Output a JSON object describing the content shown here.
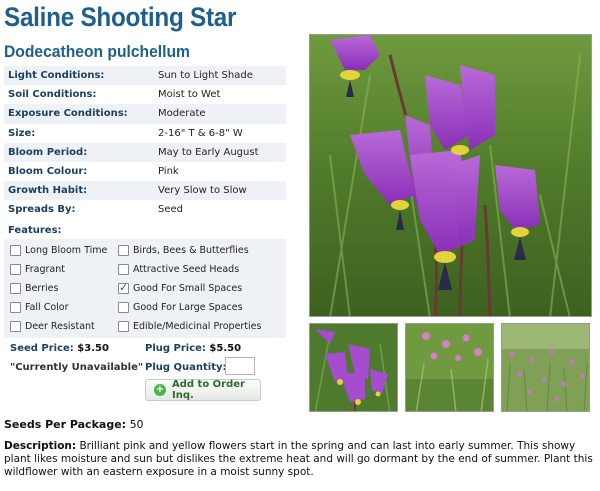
{
  "plant": {
    "common_name": "Saline Shooting Star",
    "latin_name": "Dodecatheon pulchellum"
  },
  "attributes": [
    {
      "label": "Light Conditions:",
      "value": "Sun to Light Shade"
    },
    {
      "label": "Soil Conditions:",
      "value": "Moist to Wet"
    },
    {
      "label": "Exposure Conditions:",
      "value": "Moderate"
    },
    {
      "label": "Size:",
      "value": "2-16\" T & 6-8\" W"
    },
    {
      "label": "Bloom Period:",
      "value": "May to Early August"
    },
    {
      "label": "Bloom Colour:",
      "value": "Pink"
    },
    {
      "label": "Growth Habit:",
      "value": "Very Slow to Slow"
    },
    {
      "label": "Spreads By:",
      "value": "Seed"
    }
  ],
  "features": {
    "label": "Features:",
    "items": [
      {
        "label": "Long Bloom Time",
        "checked": false
      },
      {
        "label": "Birds, Bees & Butterflies",
        "checked": false
      },
      {
        "label": "Fragrant",
        "checked": false
      },
      {
        "label": "Attractive Seed Heads",
        "checked": false
      },
      {
        "label": "Berries",
        "checked": false
      },
      {
        "label": "Good For Small Spaces",
        "checked": true
      },
      {
        "label": "Fall Color",
        "checked": false
      },
      {
        "label": "Good For Large Spaces",
        "checked": false
      },
      {
        "label": "Deer Resistant",
        "checked": false
      },
      {
        "label": "Edible/Medicinal Properties",
        "checked": false
      }
    ]
  },
  "pricing": {
    "seed_label": "Seed Price:",
    "seed_price": "$3.50",
    "seed_status": "\"Currently Unavailable\"",
    "plug_label": "Plug Price:",
    "plug_price": "$5.50",
    "plug_qty_label": "Plug Quantity:",
    "plug_qty_value": "",
    "order_button": "Add to Order Inq."
  },
  "seeds_per_package": {
    "label": "Seeds Per Package:",
    "value": "50"
  },
  "description": {
    "label": "Description:",
    "text": "Brilliant pink and yellow flowers start in the spring and can last into early summer. This showy plant likes moisture and sun but dislikes the extreme heat and will go dormant by the end of summer. Plant this wildflower with an eastern exposure in a moist sunny spot."
  },
  "icons": {
    "order": "plus-circle-icon",
    "check": "checkmark-icon"
  },
  "colors": {
    "heading": "#1f5f8c",
    "row_alt": "#eef2f6",
    "button_text": "#2e6b2e"
  }
}
